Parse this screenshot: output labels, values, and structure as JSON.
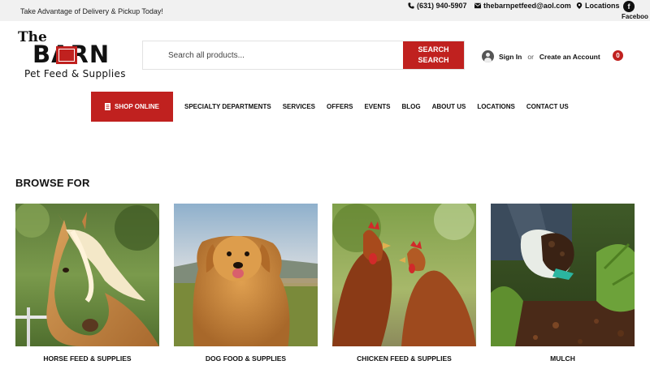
{
  "topbar": {
    "promo": "Take Advantage of Delivery & Pickup Today!",
    "phone": "(631) 940-5907",
    "email": "thebarnpetfeed@aol.com",
    "locations": "Locations",
    "facebook_icon": "f",
    "facebook_label": "Faceboo"
  },
  "logo": {
    "the": "The",
    "barn": "BARN",
    "sub": "Pet Feed & Supplies"
  },
  "search": {
    "placeholder": "Search all products...",
    "button_line1": "SEARCH",
    "button_line2": "SEARCH"
  },
  "account": {
    "sign_in": "Sign In",
    "or": "or",
    "create": "Create an Account",
    "cart_count": "0"
  },
  "nav": {
    "shop_online": "SHOP ONLINE",
    "items": [
      "SPECIALTY DEPARTMENTS",
      "SERVICES",
      "OFFERS",
      "EVENTS",
      "BLOG",
      "ABOUT US",
      "LOCATIONS",
      "CONTACT US"
    ]
  },
  "browse": {
    "title": "BROWSE FOR",
    "categories": [
      {
        "label": "HORSE FEED & SUPPLIES"
      },
      {
        "label": "DOG FOOD & SUPPLIES"
      },
      {
        "label": "CHICKEN FEED & SUPPLIES"
      },
      {
        "label": "MULCH"
      }
    ]
  },
  "colors": {
    "accent": "#c0211f",
    "topbar_bg": "#f1f1f1"
  }
}
